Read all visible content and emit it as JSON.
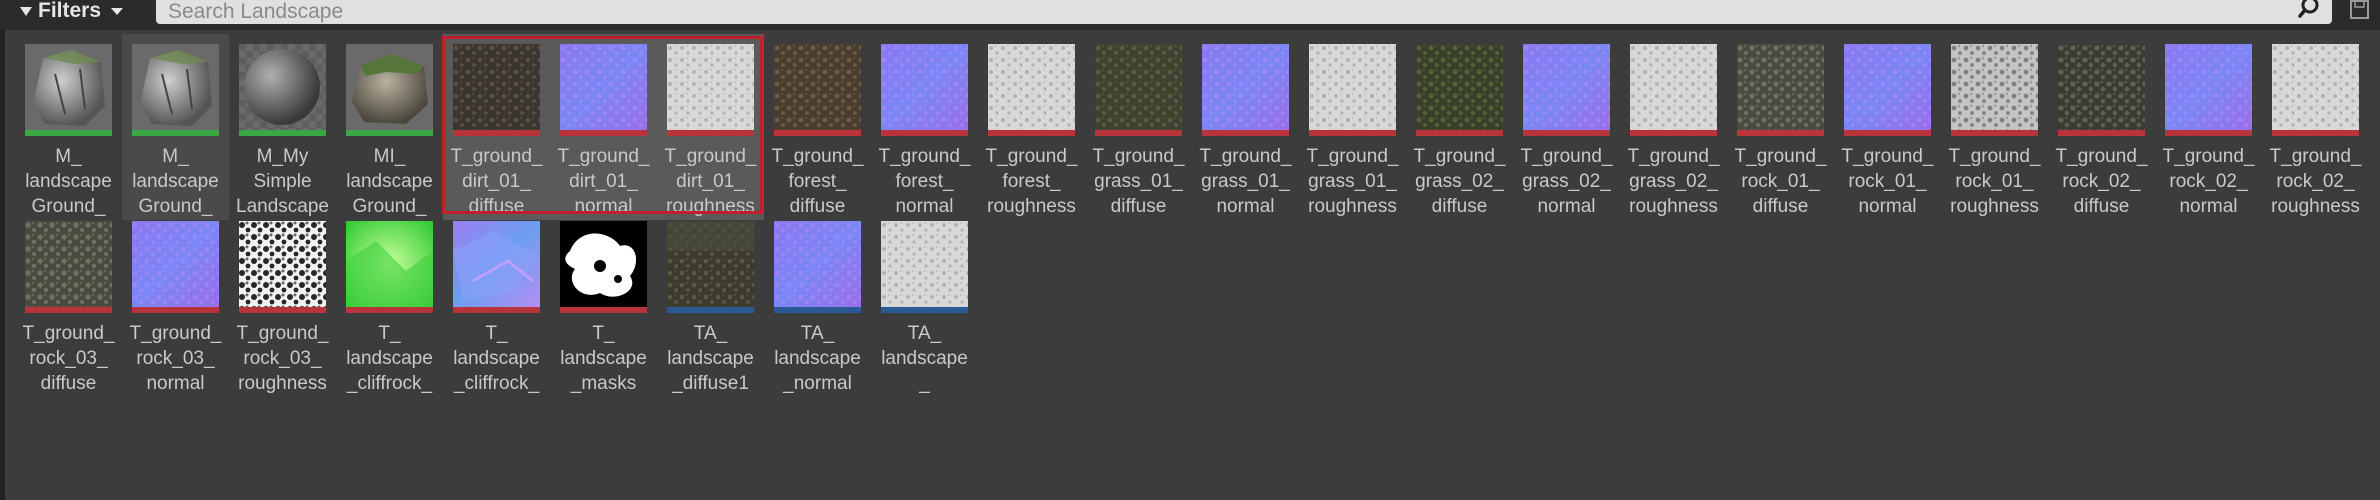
{
  "toolbar": {
    "filters_label": "Filters",
    "search_placeholder": "Search Landscape",
    "icons": [
      "filter-icon",
      "chevron-down-icon",
      "search-icon",
      "save-icon"
    ]
  },
  "colors": {
    "material": "#3aa844",
    "texture": "#b8343a",
    "texture_array": "#2a5a94",
    "selection": "#c0202a"
  },
  "assets": [
    {
      "label": "M_\nlandscape\nGround_",
      "thumb": "rock",
      "type": "material"
    },
    {
      "label": "M_\nlandscape\nGround_",
      "thumb": "rock",
      "type": "material"
    },
    {
      "label": "M_My\nSimple\nLandscape",
      "thumb": "sphere",
      "type": "material"
    },
    {
      "label": "MI_\nlandscape\nGround_",
      "thumb": "rockmoss",
      "type": "material"
    },
    {
      "label": "T_ground_\ndirt_01_\ndiffuse",
      "thumb": "dirt",
      "type": "texture"
    },
    {
      "label": "T_ground_\ndirt_01_\nnormal",
      "thumb": "normal",
      "type": "texture"
    },
    {
      "label": "T_ground_\ndirt_01_\nroughness",
      "thumb": "rough",
      "type": "texture"
    },
    {
      "label": "T_ground_\nforest_\ndiffuse",
      "thumb": "forest",
      "type": "texture"
    },
    {
      "label": "T_ground_\nforest_\nnormal",
      "thumb": "normal",
      "type": "texture"
    },
    {
      "label": "T_ground_\nforest_\nroughness",
      "thumb": "rough",
      "type": "texture"
    },
    {
      "label": "T_ground_\ngrass_01_\ndiffuse",
      "thumb": "grass",
      "type": "texture"
    },
    {
      "label": "T_ground_\ngrass_01_\nnormal",
      "thumb": "normal",
      "type": "texture"
    },
    {
      "label": "T_ground_\ngrass_01_\nroughness",
      "thumb": "rough",
      "type": "texture"
    },
    {
      "label": "T_ground_\ngrass_02_\ndiffuse",
      "thumb": "grass2",
      "type": "texture"
    },
    {
      "label": "T_ground_\ngrass_02_\nnormal",
      "thumb": "normal",
      "type": "texture"
    },
    {
      "label": "T_ground_\ngrass_02_\nroughness",
      "thumb": "rough",
      "type": "texture"
    },
    {
      "label": "T_ground_\nrock_01_\ndiffuse",
      "thumb": "rockdiff",
      "type": "texture"
    },
    {
      "label": "T_ground_\nrock_01_\nnormal",
      "thumb": "normal",
      "type": "texture"
    },
    {
      "label": "T_ground_\nrock_01_\nroughness",
      "thumb": "roughdark",
      "type": "texture"
    },
    {
      "label": "T_ground_\nrock_02_\ndiffuse",
      "thumb": "rockdiff2",
      "type": "texture"
    },
    {
      "label": "T_ground_\nrock_02_\nnormal",
      "thumb": "normal",
      "type": "texture"
    },
    {
      "label": "T_ground_\nrock_02_\nroughness",
      "thumb": "rough",
      "type": "texture"
    },
    {
      "label": "T_ground_\nrock_03_\ndiffuse",
      "thumb": "rockdiff",
      "type": "texture"
    },
    {
      "label": "T_ground_\nrock_03_\nnormal",
      "thumb": "normal",
      "type": "texture"
    },
    {
      "label": "T_ground_\nrock_03_\nroughness",
      "thumb": "bw",
      "type": "texture"
    },
    {
      "label": "T_\nlandscape\n_cliffrock_",
      "thumb": "green",
      "type": "texture"
    },
    {
      "label": "T_\nlandscape\n_cliffrock_",
      "thumb": "normalbig",
      "type": "texture"
    },
    {
      "label": "T_\nlandscape\n_masks",
      "thumb": "mask",
      "type": "texture"
    },
    {
      "label": "TA_\nlandscape\n_diffuse1",
      "thumb": "tadiff",
      "type": "texture_array"
    },
    {
      "label": "TA_\nlandscape\n_normal",
      "thumb": "normal",
      "type": "texture_array"
    },
    {
      "label": "TA_\nlandscape\n_",
      "thumb": "rough",
      "type": "texture_array"
    }
  ]
}
